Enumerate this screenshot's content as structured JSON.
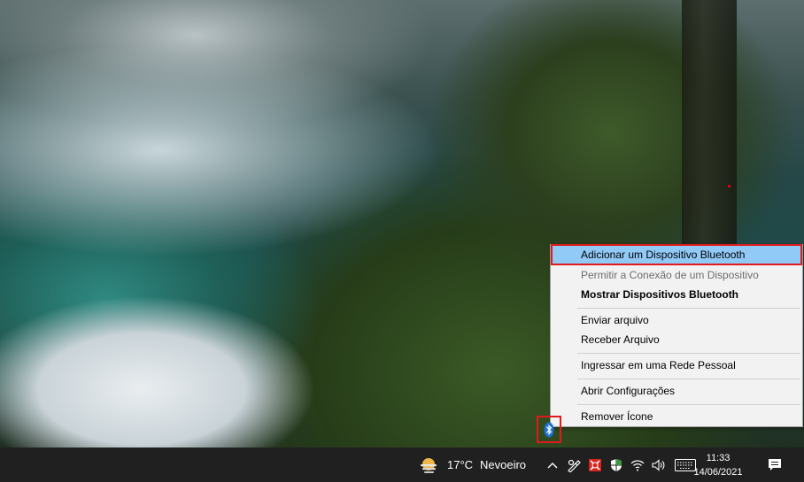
{
  "menu": {
    "items": [
      {
        "label": "Adicionar um Dispositivo Bluetooth",
        "state": "highlighted"
      },
      {
        "label": "Permitir a Conexão de um Dispositivo",
        "state": "disabled"
      },
      {
        "label": "Mostrar Dispositivos Bluetooth",
        "state": "bold"
      },
      {
        "label": "Enviar arquivo",
        "state": "normal"
      },
      {
        "label": "Receber Arquivo",
        "state": "normal"
      },
      {
        "label": "Ingressar em uma Rede Pessoal",
        "state": "normal"
      },
      {
        "label": "Abrir Configurações",
        "state": "normal"
      },
      {
        "label": "Remover Ícone",
        "state": "normal"
      }
    ]
  },
  "taskbar": {
    "weather": {
      "temp": "17°C",
      "condition": "Nevoeiro",
      "icon": "fog-sun-icon"
    },
    "tray_icons": [
      "chevron-up-icon",
      "pen-workspace-icon",
      "antivirus-icon",
      "windows-security-icon",
      "wifi-icon",
      "speaker-icon",
      "keyboard-icon"
    ],
    "clock": {
      "time": "11:33",
      "date": "14/06/2021"
    },
    "notification_icon": "action-center-icon"
  },
  "highlight_color": "#e01b1b",
  "bluetooth_icon": "bluetooth-icon"
}
